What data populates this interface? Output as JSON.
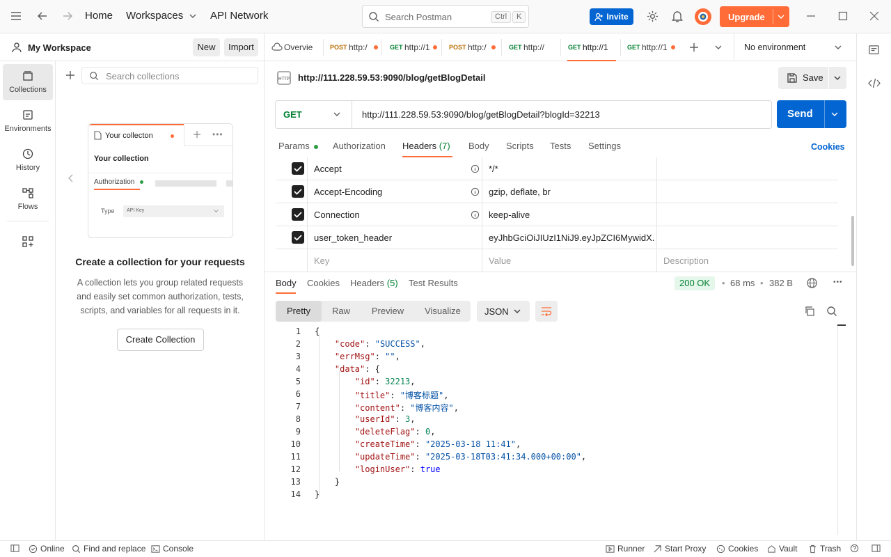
{
  "topbar": {
    "home": "Home",
    "workspaces": "Workspaces",
    "api_network": "API Network",
    "search_placeholder": "Search Postman",
    "kbd_ctrl": "Ctrl",
    "kbd_k": "K",
    "invite": "Invite",
    "upgrade": "Upgrade"
  },
  "sidebar": {
    "workspace_name": "My Workspace",
    "new_label": "New",
    "import_label": "Import",
    "rail": [
      {
        "label": "Collections",
        "icon": "collections-icon"
      },
      {
        "label": "Environments",
        "icon": "environments-icon"
      },
      {
        "label": "History",
        "icon": "history-icon"
      },
      {
        "label": "Flows",
        "icon": "flows-icon"
      }
    ],
    "search_placeholder": "Search collections",
    "illustration": {
      "tab_name": "Your collecton",
      "heading": "Your collection",
      "auth_label": "Authorization",
      "type_label": "Type",
      "type_value": "API Key"
    },
    "empty_title": "Create a collection for your requests",
    "empty_body": "A collection lets you group related requests and easily set common authorization, tests, scripts, and variables for all requests in it.",
    "create_button": "Create Collection"
  },
  "tabs": [
    {
      "method": "",
      "label": "Overvie",
      "dot": false,
      "active": false
    },
    {
      "method": "POST",
      "label": "http:/",
      "dot": true,
      "active": false
    },
    {
      "method": "GET",
      "label": "http://1",
      "dot": true,
      "active": false
    },
    {
      "method": "POST",
      "label": "http:/",
      "dot": true,
      "active": false
    },
    {
      "method": "GET",
      "label": "http://",
      "dot": false,
      "active": false
    },
    {
      "method": "GET",
      "label": "http://1",
      "dot": false,
      "active": true
    },
    {
      "method": "GET",
      "label": "http://1",
      "dot": true,
      "active": false
    }
  ],
  "environment": "No environment",
  "request": {
    "title": "http://111.228.59.53:9090/blog/getBlogDetail",
    "save": "Save",
    "method": "GET",
    "url": "http://111.228.59.53:9090/blog/getBlogDetail?blogId=32213",
    "send": "Send",
    "subtabs": {
      "params": "Params",
      "authorization": "Authorization",
      "headers": "Headers",
      "headers_count": "(7)",
      "body": "Body",
      "scripts": "Scripts",
      "tests": "Tests",
      "settings": "Settings",
      "cookies": "Cookies"
    },
    "headers": [
      {
        "key": "Accept",
        "value": "*/*"
      },
      {
        "key": "Accept-Encoding",
        "value": "gzip, deflate, br"
      },
      {
        "key": "Connection",
        "value": "keep-alive"
      },
      {
        "key": "user_token_header",
        "value": "eyJhbGciOiJIUzI1NiJ9.eyJpZCI6MywidX..."
      }
    ],
    "placeholders": {
      "key": "Key",
      "value": "Value",
      "description": "Description"
    }
  },
  "response": {
    "tabs": {
      "body": "Body",
      "cookies": "Cookies",
      "headers": "Headers",
      "headers_count": "(5)",
      "test_results": "Test Results"
    },
    "status": "200 OK",
    "time": "68 ms",
    "size": "382 B",
    "views": {
      "pretty": "Pretty",
      "raw": "Raw",
      "preview": "Preview",
      "visualize": "Visualize"
    },
    "format": "JSON",
    "line_numbers": [
      "1",
      "2",
      "3",
      "4",
      "5",
      "6",
      "7",
      "8",
      "9",
      "10",
      "11",
      "12",
      "13",
      "14"
    ],
    "json": {
      "code_key": "\"code\"",
      "code_val": "\"SUCCESS\"",
      "errmsg_key": "\"errMsg\"",
      "errmsg_val": "\"\"",
      "data_key": "\"data\"",
      "id_key": "\"id\"",
      "id_val": "32213",
      "title_key": "\"title\"",
      "title_val": "\"博客标题\"",
      "content_key": "\"content\"",
      "content_val": "\"博客内容\"",
      "userid_key": "\"userId\"",
      "userid_val": "3",
      "deleteflag_key": "\"deleteFlag\"",
      "deleteflag_val": "0",
      "createtime_key": "\"createTime\"",
      "createtime_val": "\"2025-03-18 11:41\"",
      "updatetime_key": "\"updateTime\"",
      "updatetime_val": "\"2025-03-18T03:41:34.000+00:00\"",
      "loginuser_key": "\"loginUser\"",
      "loginuser_val": "true"
    }
  },
  "statusbar": {
    "online": "Online",
    "find_replace": "Find and replace",
    "console": "Console",
    "runner": "Runner",
    "start_proxy": "Start Proxy",
    "cookies": "Cookies",
    "vault": "Vault",
    "trash": "Trash"
  },
  "colors": {
    "brand_orange": "#ff6c37",
    "accent_blue": "#0265d2",
    "success_green": "#007f31"
  }
}
